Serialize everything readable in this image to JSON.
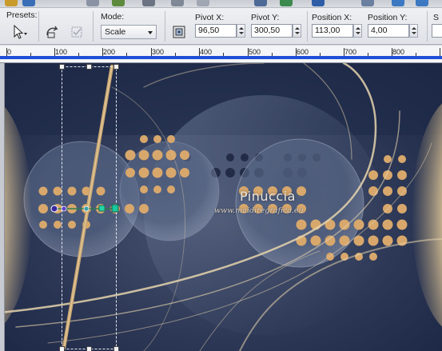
{
  "options_bar": {
    "presets_label": "Presets:",
    "mode_label": "Mode:",
    "mode_value": "Scale",
    "pivot_x_label": "Pivot X:",
    "pivot_x_value": "96,50",
    "pivot_y_label": "Pivot Y:",
    "pivot_y_value": "300,50",
    "position_x_label": "Position X:",
    "position_x_value": "113,00",
    "position_y_label": "Position Y:",
    "position_y_value": "4,00",
    "cut_label": "S"
  },
  "ruler": {
    "ticks": [
      "0",
      "100",
      "200",
      "300",
      "400",
      "500",
      "600",
      "700",
      "800"
    ]
  },
  "canvas": {
    "watermark_title": "Pinuccia",
    "watermark_url": "www.maidiregrafica.eu"
  },
  "colors": {
    "ruler_accent": "#1f4fd8",
    "canvas_dark": "#243150",
    "canvas_gold": "#e0b27a"
  }
}
